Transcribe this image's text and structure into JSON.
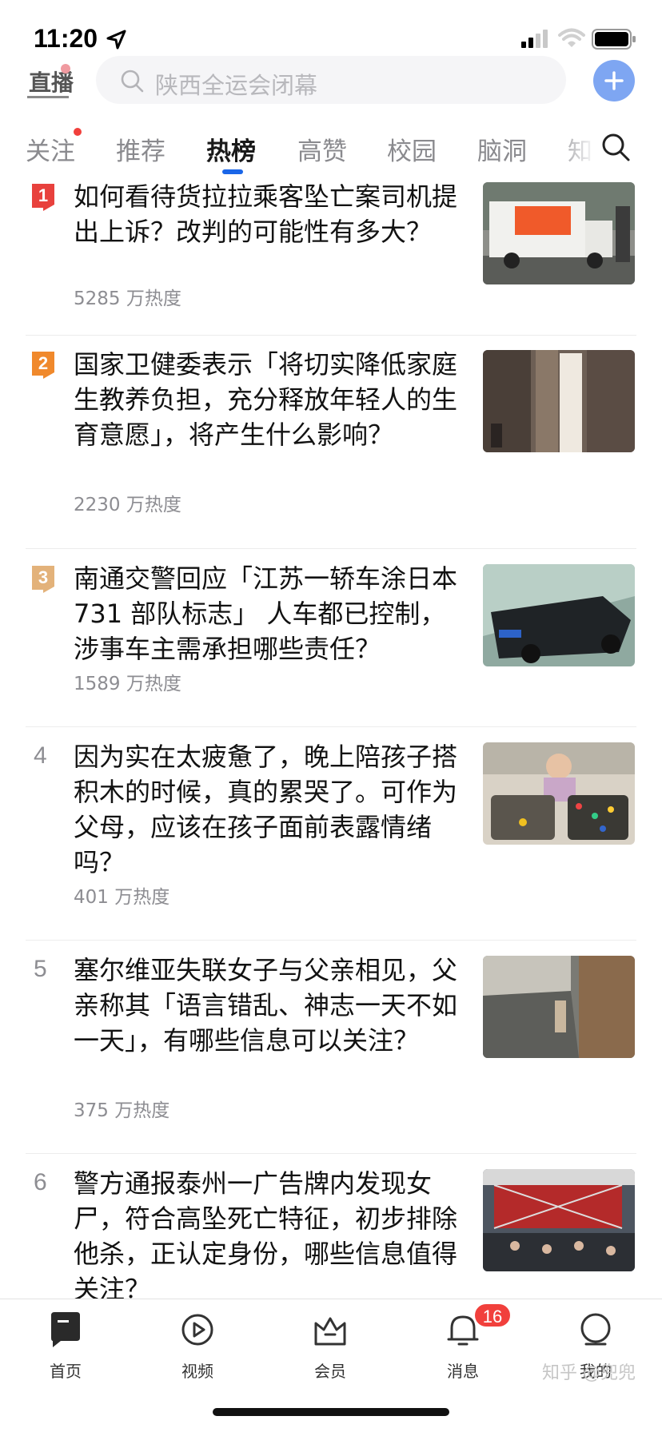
{
  "status_bar": {
    "time": "11:20",
    "icons": [
      "location-arrow-icon",
      "cellular-signal-icon",
      "wifi-icon",
      "battery-icon"
    ]
  },
  "top_bar": {
    "live_label": "直播",
    "search_placeholder": "陕西全运会闭幕",
    "add_icon": "plus-icon"
  },
  "tabs": [
    {
      "label": "关注",
      "active": false,
      "has_dot": true
    },
    {
      "label": "推荐",
      "active": false
    },
    {
      "label": "热榜",
      "active": true
    },
    {
      "label": "高赞",
      "active": false
    },
    {
      "label": "校园",
      "active": false
    },
    {
      "label": "脑洞",
      "active": false
    },
    {
      "label": "知",
      "active": false
    }
  ],
  "hot_list": [
    {
      "rank": "1",
      "title": "如何看待货拉拉乘客坠亡案司机提出上诉？改判的可能性有多大？",
      "heat": "5285 万热度",
      "image": "photo-truck-on-street",
      "badge_color": "#e8413d"
    },
    {
      "rank": "2",
      "title": "国家卫健委表示「将切实降低家庭生教养负担，充分释放年轻人的生育意愿」，将产生什么影响？",
      "heat": "2230 万热度",
      "image": "photo-health-commission-sign",
      "badge_color": "#f0892c"
    },
    {
      "rank": "3",
      "title": "南通交警回应「江苏一轿车涂日本 731 部队标志」 人车都已控制，涉事车主需承担哪些责任？",
      "heat": "1589 万热度",
      "image": "photo-black-sedan-on-bridge",
      "badge_color": "#e3b27a"
    },
    {
      "rank": "4",
      "title": "因为实在太疲惫了，晚上陪孩子搭积木的时候，真的累哭了。可作为父母，应该在孩子面前表露情绪吗？",
      "heat": "401 万热度",
      "image": "photo-child-with-building-blocks"
    },
    {
      "rank": "5",
      "title": "塞尔维亚失联女子与父亲相见，父亲称其「语言错乱、神志一天不如一天」，有哪些信息可以关注？",
      "heat": "375 万热度",
      "image": "photo-street-scene"
    },
    {
      "rank": "6",
      "title": "警方通报泰州一广告牌内发现女尸，符合高坠死亡特征，初步排除他杀，正认定身份，哪些信息值得关注？",
      "heat": "",
      "image": "photo-billboard-crowd"
    }
  ],
  "bottom_nav": [
    {
      "label": "首页",
      "icon": "home-icon",
      "active": true
    },
    {
      "label": "视频",
      "icon": "video-play-icon",
      "active": false
    },
    {
      "label": "会员",
      "icon": "crown-icon",
      "active": false
    },
    {
      "label": "消息",
      "icon": "bell-icon",
      "active": false,
      "badge": "16"
    },
    {
      "label": "我的",
      "icon": "profile-icon",
      "active": false
    }
  ],
  "watermark": "知乎 @兜兜",
  "colors": {
    "accent_blue": "#1a66e8",
    "add_button": "#7ea6f2",
    "badge_red": "#f1403c",
    "rank1": "#e8413d",
    "rank2": "#f0892c",
    "rank3": "#e3b27a",
    "secondary_text": "#8d8d92"
  }
}
